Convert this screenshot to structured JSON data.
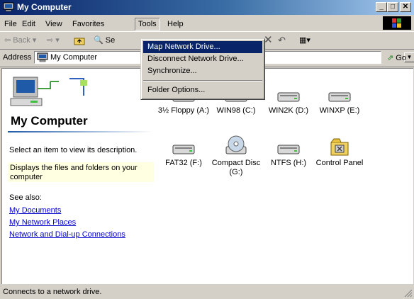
{
  "window": {
    "title": "My Computer"
  },
  "menu": [
    "File",
    "Edit",
    "View",
    "Favorites",
    "Tools",
    "Help"
  ],
  "toolbar": {
    "back": "Back",
    "search": "Se"
  },
  "address": {
    "label": "Address",
    "value": "My Computer",
    "go": "Go"
  },
  "tools_menu": {
    "items": [
      "Map Network Drive...",
      "Disconnect Network Drive...",
      "Synchronize...",
      "Folder Options..."
    ],
    "highlighted": "Map Network Drive..."
  },
  "left_panel": {
    "title": "My Computer",
    "description": "Select an item to view its description.",
    "info": "Displays the files and folders on your computer",
    "see_also": "See also:",
    "links": [
      "My Documents",
      "My Network Places",
      "Network and Dial-up Connections"
    ]
  },
  "drives": [
    {
      "label": "3½ Floppy (A:)",
      "icon": "floppy-drive-icon"
    },
    {
      "label": "WIN98 (C:)",
      "icon": "hard-drive-icon"
    },
    {
      "label": "WIN2K (D:)",
      "icon": "hard-drive-icon"
    },
    {
      "label": "WINXP (E:)",
      "icon": "hard-drive-icon"
    },
    {
      "label": "FAT32 (F:)",
      "icon": "hard-drive-icon"
    },
    {
      "label": "Compact Disc (G:)",
      "icon": "cd-drive-icon"
    },
    {
      "label": "NTFS (H:)",
      "icon": "hard-drive-icon"
    },
    {
      "label": "Control Panel",
      "icon": "control-panel-icon"
    }
  ],
  "status": {
    "text": "Connects to a network drive."
  }
}
